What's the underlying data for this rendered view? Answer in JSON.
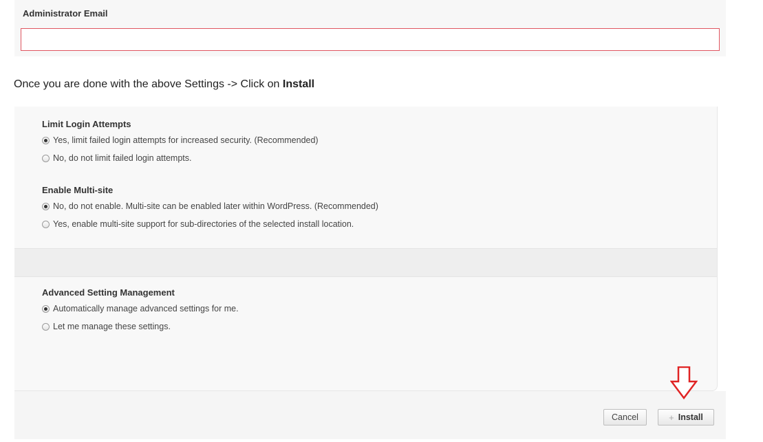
{
  "email": {
    "label": "Administrator Email",
    "value": "",
    "placeholder": ""
  },
  "instruction": {
    "prefix": "Once you are done with the above Settings -> Click on ",
    "bold": "Install"
  },
  "settings": {
    "limit_login": {
      "title": "Limit Login Attempts",
      "options": [
        {
          "label": "Yes, limit failed login attempts for increased security. (Recommended)",
          "selected": true
        },
        {
          "label": "No, do not limit failed login attempts.",
          "selected": false
        }
      ]
    },
    "multisite": {
      "title": "Enable Multi-site",
      "options": [
        {
          "label": "No, do not enable. Multi-site can be enabled later within WordPress. (Recommended)",
          "selected": true
        },
        {
          "label": "Yes, enable multi-site support for sub-directories of the selected install location.",
          "selected": false
        }
      ]
    },
    "advanced": {
      "title": "Advanced Setting Management",
      "options": [
        {
          "label": "Automatically manage advanced settings for me.",
          "selected": true
        },
        {
          "label": "Let me manage these settings.",
          "selected": false
        }
      ]
    }
  },
  "footer": {
    "cancel_label": "Cancel",
    "install_label": "Install",
    "install_icon": "plus-icon"
  },
  "annotation": {
    "arrow_color": "#e02424",
    "arrow_icon": "down-arrow-icon"
  },
  "colors": {
    "input_error_border": "#e05560",
    "panel_background": "#f8f8f8"
  }
}
